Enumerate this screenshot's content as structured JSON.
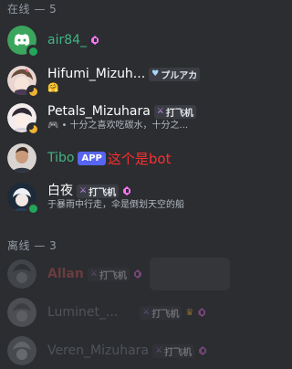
{
  "sections": {
    "online_header": "在线 — 5",
    "offline_header": "离线 — 3"
  },
  "members": {
    "air84": {
      "name": "air84_",
      "name_color": "#43b581"
    },
    "hifumi": {
      "name": "Hifumi_Mizuh...",
      "tag": "プルアカ",
      "status_emoji": "🤗",
      "name_color": "#ffffff"
    },
    "petals": {
      "name": "Petals_Mizuhara",
      "tag": "打飞机",
      "activity": "• 十分之喜欢吃碳水，十分之...",
      "name_color": "#ffffff"
    },
    "tibo": {
      "name": "Tibo",
      "badge": "APP",
      "annotation": "这个是bot",
      "name_color": "#43b581"
    },
    "baiye": {
      "name": "白夜",
      "tag": "打飞机",
      "activity": "于暴雨中行走，伞是倒划天空的船",
      "name_color": "#ffffff"
    },
    "allan": {
      "name": "Allan",
      "tag": "打飞机",
      "name_color": "#e05a5a"
    },
    "luminet": {
      "name": "Luminet_...",
      "tag": "打飞机",
      "name_color": "#949ba4"
    },
    "veren": {
      "name": "Veren_Mizuhara",
      "tag": "打飞机",
      "name_color": "#949ba4"
    }
  },
  "colors": {
    "background": "#2b2d31",
    "online": "#23a55a",
    "idle": "#f0b232",
    "boost": "#ff73fa",
    "app_badge": "#5865f2",
    "annotation": "#ff2d2d"
  }
}
